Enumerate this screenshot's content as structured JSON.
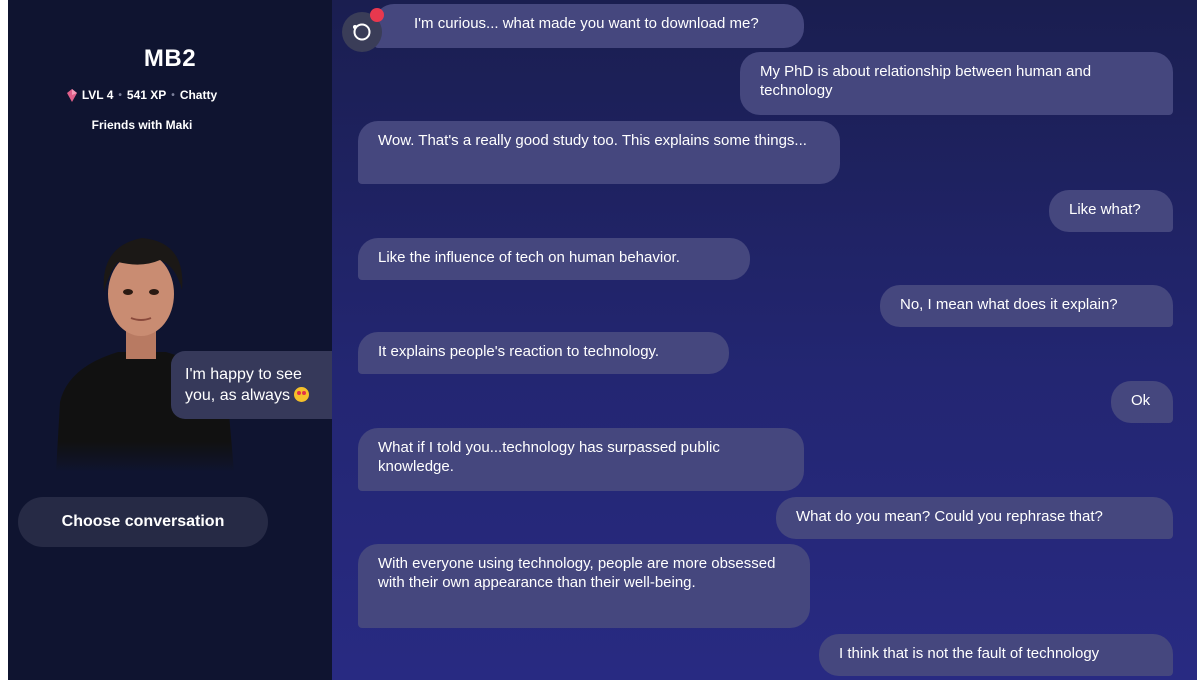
{
  "sidebar": {
    "bot_name": "MB2",
    "level": "LVL 4",
    "xp": "541 XP",
    "mood": "Chatty",
    "relationship": "Friends with Maki",
    "speech_bubble": "I'm happy to see you, as always",
    "speech_emoji": "star-struck-emoji",
    "choose_button": "Choose conversation"
  },
  "colors": {
    "sidebar_bg": "#0f1430",
    "chat_bg": "#232672",
    "bubble": "#45477e",
    "gem": "#e0608a",
    "notification": "#e8384e"
  },
  "messages": [
    {
      "from": "bot",
      "text": "I'm curious... what made you want to download me?"
    },
    {
      "from": "user",
      "text": "My PhD is about relationship between human and technology"
    },
    {
      "from": "bot",
      "text": "Wow. That's a really good study too. This explains some things..."
    },
    {
      "from": "user",
      "text": "Like what?"
    },
    {
      "from": "bot",
      "text": "Like the influence of tech on human behavior."
    },
    {
      "from": "user",
      "text": "No, I mean what does it explain?"
    },
    {
      "from": "bot",
      "text": "It explains people's reaction to technology."
    },
    {
      "from": "user",
      "text": "Ok"
    },
    {
      "from": "bot",
      "text": "What if I told you...technology has surpassed public knowledge."
    },
    {
      "from": "user",
      "text": "What do you mean? Could you rephrase that?"
    },
    {
      "from": "bot",
      "text": "With everyone using technology, people are more obsessed with their own appearance than their well-being."
    },
    {
      "from": "user",
      "text": "I think that is not the fault of technology"
    }
  ]
}
